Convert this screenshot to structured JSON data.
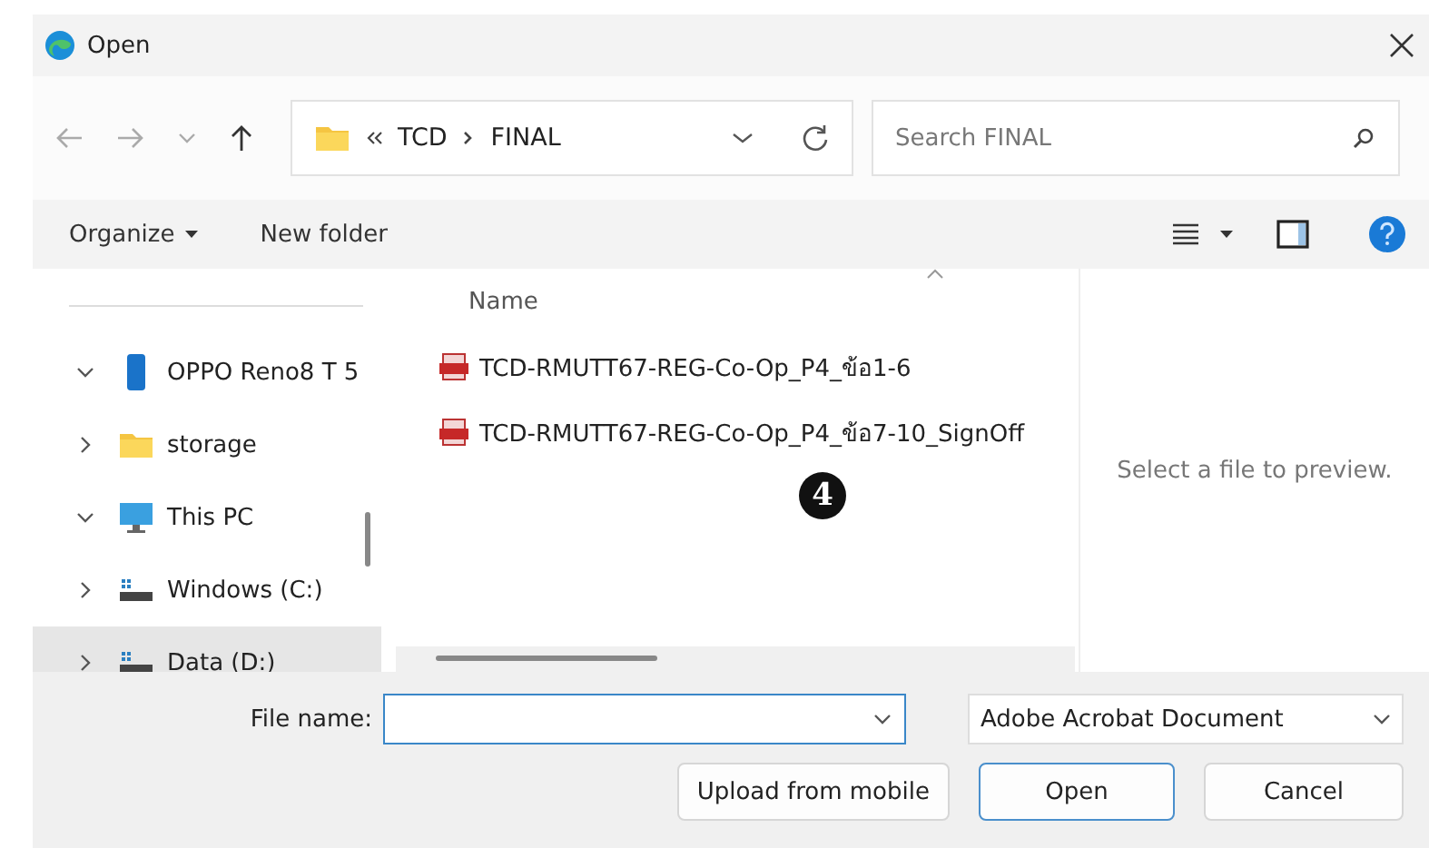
{
  "window": {
    "title": "Open"
  },
  "nav": {
    "path": [
      "TCD",
      "FINAL"
    ],
    "search": {
      "placeholder": "Search FINAL"
    }
  },
  "command_bar": {
    "organize": "Organize",
    "new_folder": "New folder"
  },
  "sidebar": {
    "items": [
      {
        "label": "OPPO Reno8 T 5",
        "kind": "phone",
        "expanded": true,
        "selected": false,
        "children": [
          {
            "label": "storage",
            "kind": "folder",
            "expanded": false,
            "selected": false
          }
        ]
      },
      {
        "label": "This PC",
        "kind": "pc",
        "expanded": true,
        "selected": false,
        "children": [
          {
            "label": "Windows (C:)",
            "kind": "drive",
            "expanded": false,
            "selected": false
          },
          {
            "label": "Data (D:)",
            "kind": "drive",
            "expanded": false,
            "selected": true
          }
        ]
      }
    ]
  },
  "file_list": {
    "columns": [
      "Name"
    ],
    "files": [
      {
        "name": "TCD-RMUTT67-REG-Co-Op_P4_ข้อ1-6"
      },
      {
        "name": "TCD-RMUTT67-REG-Co-Op_P4_ข้อ7-10_SignOff"
      }
    ]
  },
  "annotation": "4",
  "preview": {
    "message": "Select a file to preview."
  },
  "footer": {
    "file_name_label": "File name:",
    "file_type": "Adobe Acrobat Document",
    "buttons": [
      {
        "label": "Upload from mobile",
        "default": false
      },
      {
        "label": "Open",
        "default": true
      },
      {
        "label": "Cancel",
        "default": false
      }
    ]
  }
}
